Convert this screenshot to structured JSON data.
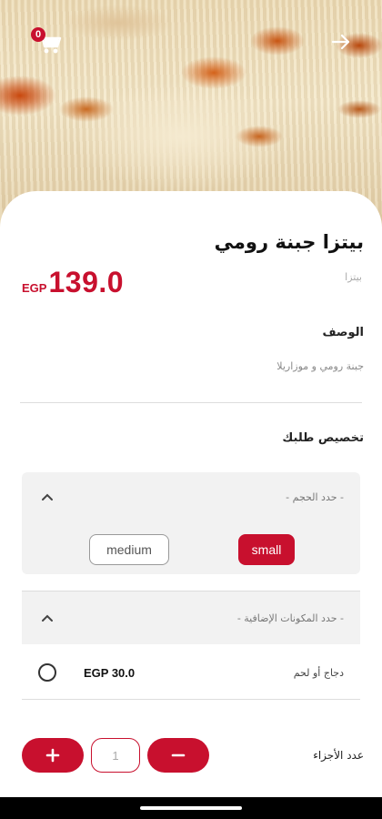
{
  "header": {
    "cart_count": "0",
    "cart_icon": "cart-icon",
    "back_icon": "arrow-right-icon"
  },
  "product": {
    "title": "بيتزا جبنة رومي",
    "category": "بيتزا",
    "price_value": "139.0",
    "price_currency": "EGP",
    "description_label": "الوصف",
    "description": "جبنة رومي و موزاريلا"
  },
  "customize": {
    "label": "تخصيص طلبك",
    "size_section": {
      "title": "- حدد الحجم -",
      "options": [
        "medium",
        "small"
      ],
      "selected": "small"
    },
    "addons_section": {
      "title": "- حدد المكونات الإضافية -",
      "items": [
        {
          "name": "دجاج أو لحم",
          "price": "EGP 30.0",
          "selected": false
        }
      ]
    }
  },
  "quantity": {
    "label": "عدد الأجزاء",
    "value": "1",
    "plus": "+",
    "minus": "−"
  },
  "colors": {
    "accent": "#c8102e"
  }
}
